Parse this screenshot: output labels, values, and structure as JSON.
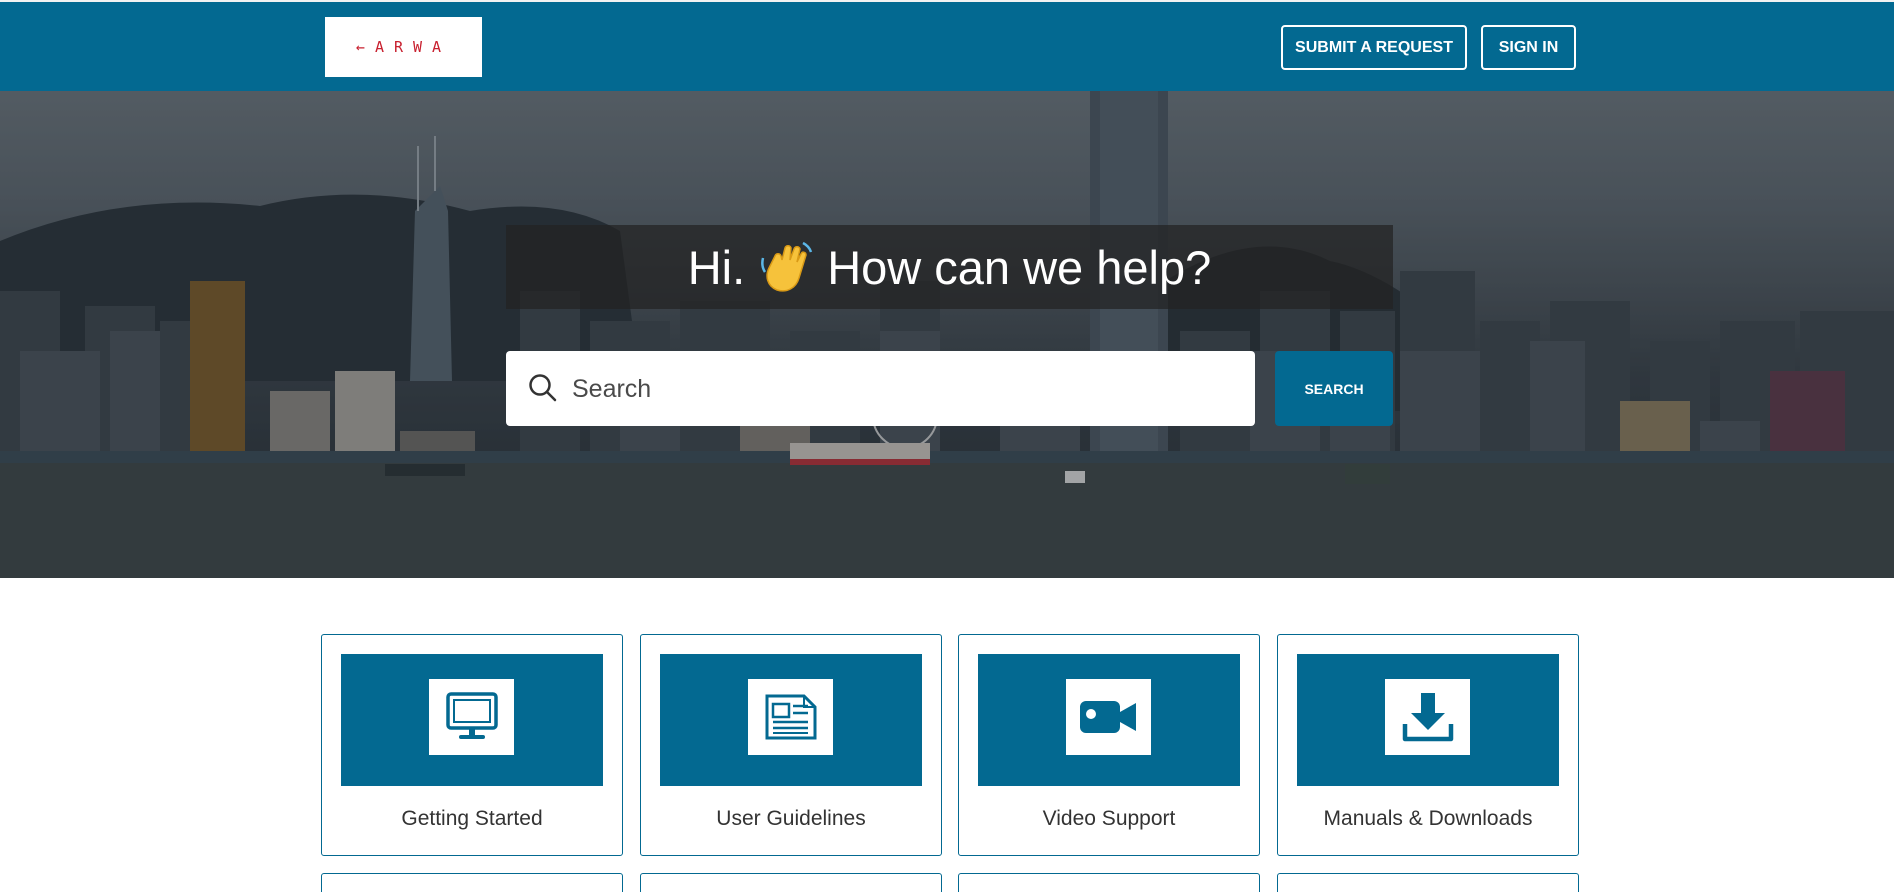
{
  "header": {
    "logo_text": "←ARWA",
    "submit_request_label": "SUBMIT A REQUEST",
    "sign_in_label": "SIGN IN"
  },
  "hero": {
    "greeting": "Hi.",
    "question": "How can we help?",
    "wave_icon": "waving-hand-emoji",
    "search": {
      "placeholder": "Search",
      "value": "",
      "button_label": "SEARCH"
    }
  },
  "categories": [
    {
      "label": "Getting Started",
      "icon": "desktop-monitor-icon"
    },
    {
      "label": "User Guidelines",
      "icon": "newspaper-document-icon"
    },
    {
      "label": "Video Support",
      "icon": "video-camera-icon"
    },
    {
      "label": "Manuals & Downloads",
      "icon": "download-icon"
    }
  ],
  "colors": {
    "brand": "#036991",
    "logo_text": "#c8202f",
    "card_text": "#333333"
  }
}
